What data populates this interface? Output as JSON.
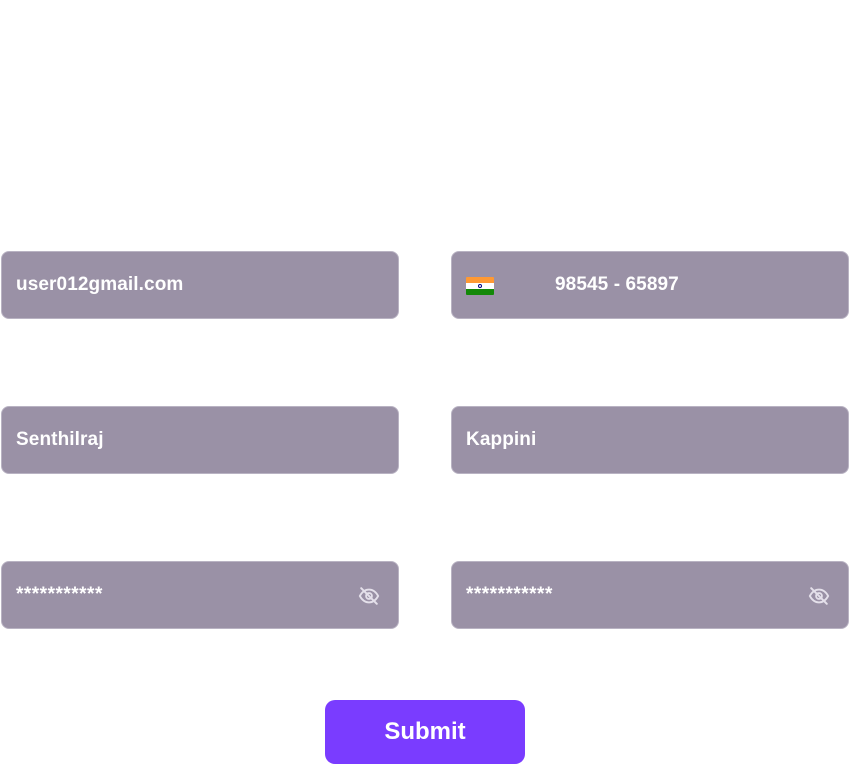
{
  "form": {
    "email": {
      "value": "user012gmail.com"
    },
    "phone": {
      "country_flag": "india-flag-icon",
      "value": "98545 - 65897"
    },
    "first_name": {
      "value": "Senthilraj"
    },
    "last_name": {
      "value": "Kappini"
    },
    "password": {
      "value": "***********",
      "toggle_icon": "eye-off-icon"
    },
    "confirm_password": {
      "value": "***********",
      "toggle_icon": "eye-off-icon"
    },
    "submit_label": "Submit"
  },
  "colors": {
    "field_background": "#9a91a6",
    "field_border": "#b9b3c3",
    "field_text": "#ffffff",
    "submit_background": "#7a3cff",
    "flag_saffron": "#ff9933",
    "flag_white": "#ffffff",
    "flag_green": "#138808",
    "flag_chakra": "#000080"
  }
}
